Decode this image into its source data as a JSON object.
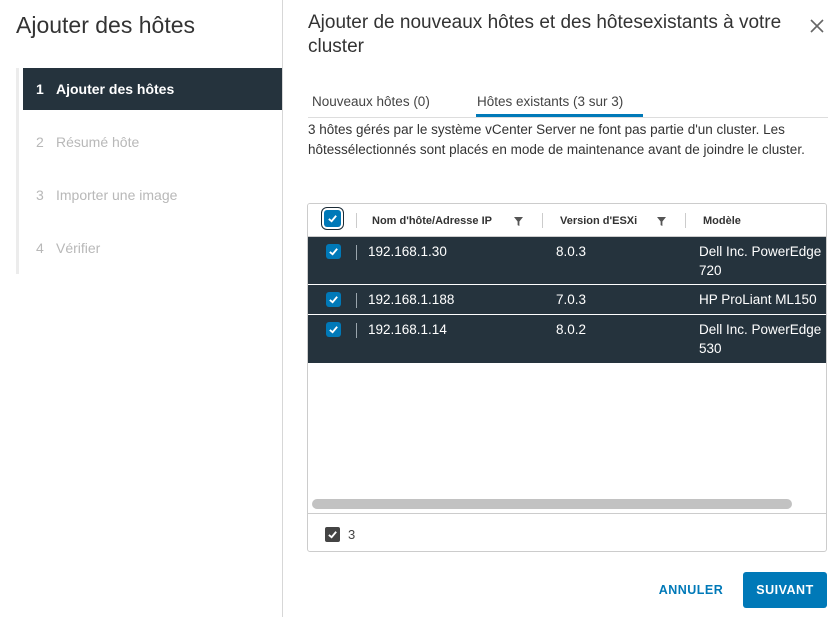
{
  "sidebar": {
    "title": "Ajouter des hôtes",
    "steps": [
      {
        "num": "1",
        "label": "Ajouter des hôtes"
      },
      {
        "num": "2",
        "label": "Résumé hôte"
      },
      {
        "num": "3",
        "label": "Importer une image"
      },
      {
        "num": "4",
        "label": "Vérifier"
      }
    ],
    "active_step": 1
  },
  "main": {
    "title": "Ajouter de nouveaux hôtes et des hôtesexistants à votre cluster",
    "close_icon": "close-icon",
    "tabs": [
      {
        "label": "Nouveaux hôtes (0)"
      },
      {
        "label": "Hôtes existants (3 sur 3)"
      }
    ],
    "active_tab": 1,
    "description": "3 hôtes gérés par le système vCenter Server ne font pas partie d'un cluster. Les hôtessélectionnés sont placés en mode de maintenance avant de joindre le cluster."
  },
  "table": {
    "columns": [
      {
        "label": "Nom d'hôte/Adresse IP"
      },
      {
        "label": "Version d'ESXi"
      },
      {
        "label": "Modèle"
      }
    ],
    "rows": [
      {
        "host": "192.168.1.30",
        "version": "8.0.3",
        "model": "Dell Inc. PowerEdge 720",
        "checked": true
      },
      {
        "host": "192.168.1.188",
        "version": "7.0.3",
        "model": "HP ProLiant ML150",
        "checked": true
      },
      {
        "host": "192.168.1.14",
        "version": "8.0.2",
        "model": "Dell Inc. PowerEdge 530",
        "checked": true
      }
    ],
    "selected_count": "3"
  },
  "buttons": {
    "cancel": "ANNULER",
    "next": "SUIVANT"
  },
  "colors": {
    "accent": "#0079b8",
    "selected_row": "#25333d"
  }
}
